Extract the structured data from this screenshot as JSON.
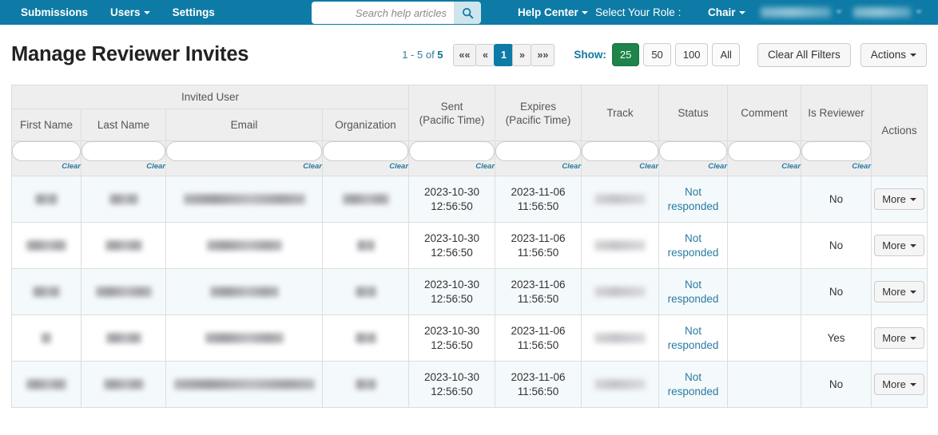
{
  "topnav": {
    "items": [
      {
        "label": "Submissions",
        "caret": false
      },
      {
        "label": "Users",
        "caret": true
      },
      {
        "label": "Settings",
        "caret": false
      }
    ],
    "search": {
      "placeholder": "Search help articles",
      "value": "",
      "icon": "search-icon"
    },
    "help_center": "Help Center",
    "role_label": "Select Your Role :",
    "role_value": "Chair",
    "redacted_items": [
      "",
      ""
    ],
    "background_color": "#0d7ba6"
  },
  "header": {
    "title": "Manage Reviewer Invites",
    "range_prefix": "1 - 5 of ",
    "range_total": "5",
    "pager": [
      {
        "label": "««",
        "active": false
      },
      {
        "label": "«",
        "active": false
      },
      {
        "label": "1",
        "active": true
      },
      {
        "label": "»",
        "active": false
      },
      {
        "label": "»»",
        "active": false
      }
    ],
    "show_label": "Show:",
    "show_options": [
      {
        "label": "25",
        "selected": true
      },
      {
        "label": "50",
        "selected": false
      },
      {
        "label": "100",
        "selected": false
      },
      {
        "label": "All",
        "selected": false
      }
    ],
    "clear_all_filters": "Clear All Filters",
    "actions": "Actions",
    "accent_color": "#0d7ba6",
    "selected_show_color": "#1e8449"
  },
  "table": {
    "group_header": "Invited User",
    "columns": [
      {
        "label": "First Name",
        "filter": "",
        "clear": "Clear"
      },
      {
        "label": "Last Name",
        "filter": "",
        "clear": "Clear"
      },
      {
        "label": "Email",
        "filter": "",
        "clear": "Clear"
      },
      {
        "label": "Organization",
        "filter": "",
        "clear": "Clear"
      },
      {
        "label": "Sent\n(Pacific Time)",
        "filter": "",
        "clear": "Clear"
      },
      {
        "label": "Expires\n(Pacific Time)",
        "filter": "",
        "clear": "Clear"
      },
      {
        "label": "Track",
        "filter": "",
        "clear": "Clear"
      },
      {
        "label": "Status",
        "filter": "",
        "clear": "Clear"
      },
      {
        "label": "Comment",
        "filter": "",
        "clear": "Clear"
      },
      {
        "label": "Is Reviewer",
        "filter": "",
        "clear": "Clear"
      },
      {
        "label": "Actions",
        "filter": null,
        "clear": null
      }
    ],
    "headers": {
      "first_name": "First Name",
      "last_name": "Last Name",
      "email": "Email",
      "organization": "Organization",
      "sent_line1": "Sent",
      "sent_line2": "(Pacific Time)",
      "expires_line1": "Expires",
      "expires_line2": "(Pacific Time)",
      "track": "Track",
      "status": "Status",
      "comment": "Comment",
      "is_reviewer": "Is Reviewer",
      "actions": "Actions"
    },
    "clear_label": "Clear",
    "rows": [
      {
        "first_name": "",
        "last_name": "",
        "email": "",
        "organization": "",
        "sent_date": "2023-10-30",
        "sent_time": "12:56:50",
        "expires_date": "2023-11-06",
        "expires_time": "11:56:50",
        "track": "",
        "status": "Not responded",
        "comment": "",
        "is_reviewer": "No",
        "action": "More"
      },
      {
        "first_name": "",
        "last_name": "",
        "email": "",
        "organization": "",
        "sent_date": "2023-10-30",
        "sent_time": "12:56:50",
        "expires_date": "2023-11-06",
        "expires_time": "11:56:50",
        "track": "",
        "status": "Not responded",
        "comment": "",
        "is_reviewer": "No",
        "action": "More"
      },
      {
        "first_name": "",
        "last_name": "",
        "email": "",
        "organization": "",
        "sent_date": "2023-10-30",
        "sent_time": "12:56:50",
        "expires_date": "2023-11-06",
        "expires_time": "11:56:50",
        "track": "",
        "status": "Not responded",
        "comment": "",
        "is_reviewer": "No",
        "action": "More"
      },
      {
        "first_name": "",
        "last_name": "",
        "email": "",
        "organization": "",
        "sent_date": "2023-10-30",
        "sent_time": "12:56:50",
        "expires_date": "2023-11-06",
        "expires_time": "11:56:50",
        "track": "",
        "status": "Not responded",
        "comment": "",
        "is_reviewer": "Yes",
        "action": "More"
      },
      {
        "first_name": "",
        "last_name": "",
        "email": "",
        "organization": "",
        "sent_date": "2023-10-30",
        "sent_time": "12:56:50",
        "expires_date": "2023-11-06",
        "expires_time": "11:56:50",
        "track": "",
        "status": "Not responded",
        "comment": "",
        "is_reviewer": "No",
        "action": "More"
      }
    ]
  }
}
